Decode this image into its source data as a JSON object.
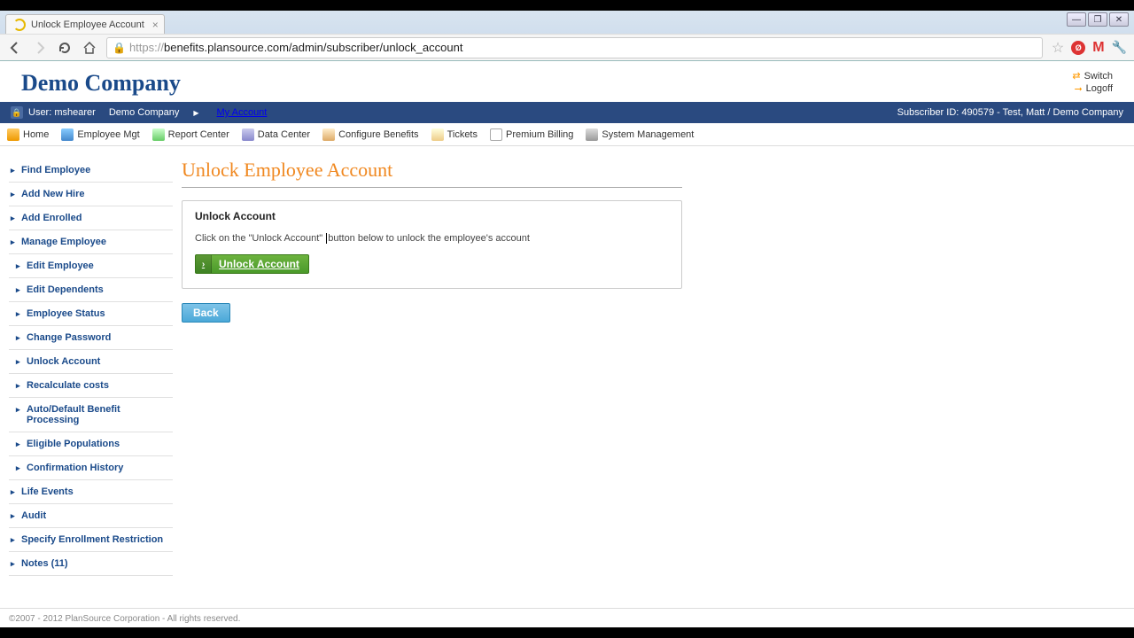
{
  "browser": {
    "tab_title": "Unlock Employee Account",
    "url_scheme": "https://",
    "url_rest": "benefits.plansource.com/admin/subscriber/unlock_account"
  },
  "header": {
    "company_name": "Demo Company",
    "links": {
      "switch": "Switch",
      "logoff": "Logoff"
    }
  },
  "band": {
    "user_label": "User: mshearer",
    "org_label": "Demo Company",
    "my_account": "My Account",
    "subscriber_label": "Subscriber ID: 490579 - Test, Matt / Demo Company"
  },
  "topnav": {
    "home": "Home",
    "employee_mgt": "Employee Mgt",
    "report_center": "Report Center",
    "data_center": "Data Center",
    "configure_benefits": "Configure Benefits",
    "tickets": "Tickets",
    "premium_billing": "Premium Billing",
    "system_management": "System Management"
  },
  "sidebar": {
    "items": [
      "Find Employee",
      "Add New Hire",
      "Add Enrolled",
      "Manage Employee",
      "Edit Employee",
      "Edit Dependents",
      "Employee Status",
      "Change Password",
      "Unlock Account",
      "Recalculate costs",
      "Auto/Default Benefit Processing",
      "Eligible Populations",
      "Confirmation History",
      "Life Events",
      "Audit",
      "Specify Enrollment Restriction",
      "Notes (11)"
    ]
  },
  "main": {
    "page_title": "Unlock Employee Account",
    "panel_title": "Unlock Account",
    "instruction_a": "Click on the \"Unlock Account\" ",
    "instruction_b": "button below to unlock the employee's account",
    "unlock_button": "Unlock Account",
    "back_button": "Back"
  },
  "footer": {
    "copyright": "©2007 - 2012 PlanSource Corporation - All rights reserved."
  }
}
